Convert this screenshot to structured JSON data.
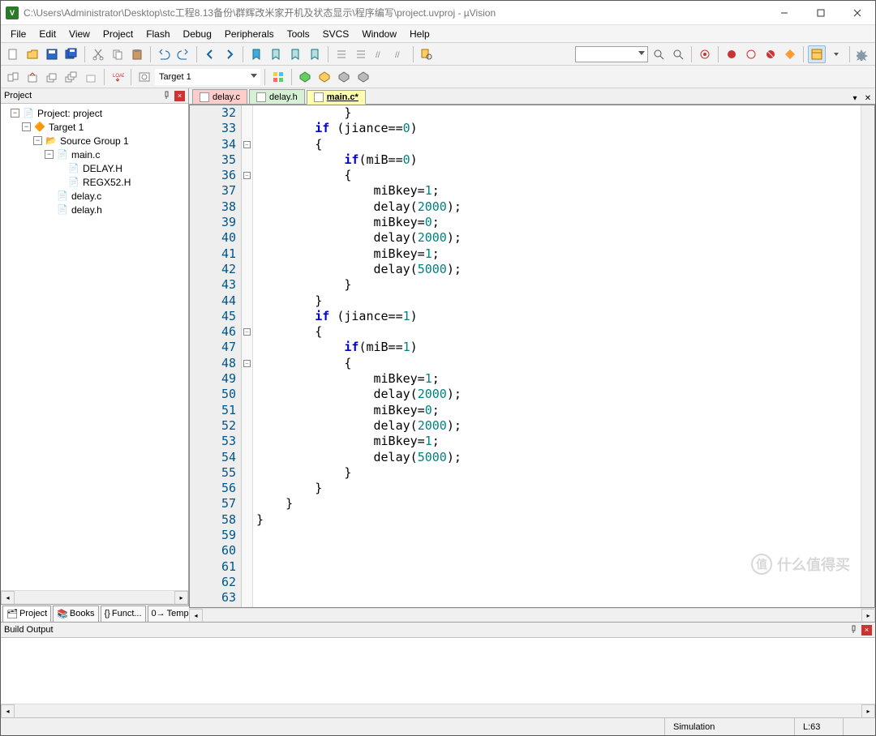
{
  "title": "C:\\Users\\Administrator\\Desktop\\stc工程8.13备份\\群辉改米家开机及状态显示\\程序编写\\project.uvproj - µVision",
  "menus": [
    "File",
    "Edit",
    "View",
    "Project",
    "Flash",
    "Debug",
    "Peripherals",
    "Tools",
    "SVCS",
    "Window",
    "Help"
  ],
  "toolbar2": {
    "target": "Target 1"
  },
  "projectPanel": {
    "title": "Project",
    "root": "Project: project",
    "target": "Target 1",
    "group": "Source Group 1",
    "files": {
      "main_c": "main.c",
      "delay_h_inc": "DELAY.H",
      "regx52": "REGX52.H",
      "delay_c": "delay.c",
      "delay_h": "delay.h"
    },
    "tabs": [
      "Project",
      "Books",
      "Funct...",
      "Templ..."
    ]
  },
  "editorTabs": {
    "t1": "delay.c",
    "t2": "delay.h",
    "t3": "main.c*"
  },
  "code": {
    "lines": [
      {
        "n": 32,
        "fold": "",
        "html": "            }"
      },
      {
        "n": 33,
        "fold": "",
        "html": "        <span class='kw'>if</span> (jiance==<span class='num'>0</span>)"
      },
      {
        "n": 34,
        "fold": "box",
        "html": "        {"
      },
      {
        "n": 35,
        "fold": "",
        "html": "            <span class='kw'>if</span>(miB==<span class='num'>0</span>)"
      },
      {
        "n": 36,
        "fold": "box",
        "html": "            {"
      },
      {
        "n": 37,
        "fold": "",
        "html": "                miBkey=<span class='num'>1</span>;"
      },
      {
        "n": 38,
        "fold": "",
        "html": "                delay(<span class='num'>2000</span>);"
      },
      {
        "n": 39,
        "fold": "",
        "html": "                miBkey=<span class='num'>0</span>;"
      },
      {
        "n": 40,
        "fold": "",
        "html": "                delay(<span class='num'>2000</span>);"
      },
      {
        "n": 41,
        "fold": "",
        "html": "                miBkey=<span class='num'>1</span>;"
      },
      {
        "n": 42,
        "fold": "",
        "html": "                delay(<span class='num'>5000</span>);"
      },
      {
        "n": 43,
        "fold": "",
        "html": "            }"
      },
      {
        "n": 44,
        "fold": "",
        "html": "        }"
      },
      {
        "n": 45,
        "fold": "",
        "html": "        <span class='kw'>if</span> (jiance==<span class='num'>1</span>)"
      },
      {
        "n": 46,
        "fold": "box",
        "html": "        {"
      },
      {
        "n": 47,
        "fold": "",
        "html": "            <span class='kw'>if</span>(miB==<span class='num'>1</span>)"
      },
      {
        "n": 48,
        "fold": "box",
        "html": "            {"
      },
      {
        "n": 49,
        "fold": "",
        "html": "                miBkey=<span class='num'>1</span>;"
      },
      {
        "n": 50,
        "fold": "",
        "html": "                delay(<span class='num'>2000</span>);"
      },
      {
        "n": 51,
        "fold": "",
        "html": "                miBkey=<span class='num'>0</span>;"
      },
      {
        "n": 52,
        "fold": "",
        "html": "                delay(<span class='num'>2000</span>);"
      },
      {
        "n": 53,
        "fold": "",
        "html": "                miBkey=<span class='num'>1</span>;"
      },
      {
        "n": 54,
        "fold": "",
        "html": "                delay(<span class='num'>5000</span>);"
      },
      {
        "n": 55,
        "fold": "",
        "html": "            }"
      },
      {
        "n": 56,
        "fold": "",
        "html": "        }"
      },
      {
        "n": 57,
        "fold": "",
        "html": "    }"
      },
      {
        "n": 58,
        "fold": "",
        "html": "}"
      },
      {
        "n": 59,
        "fold": "",
        "html": ""
      },
      {
        "n": 60,
        "fold": "",
        "html": ""
      },
      {
        "n": 61,
        "fold": "",
        "html": ""
      },
      {
        "n": 62,
        "fold": "",
        "html": ""
      },
      {
        "n": 63,
        "fold": "",
        "html": ""
      }
    ]
  },
  "buildOutput": {
    "title": "Build Output"
  },
  "statusbar": {
    "sim": "Simulation",
    "line": "L:63"
  },
  "watermark": "什么值得买"
}
